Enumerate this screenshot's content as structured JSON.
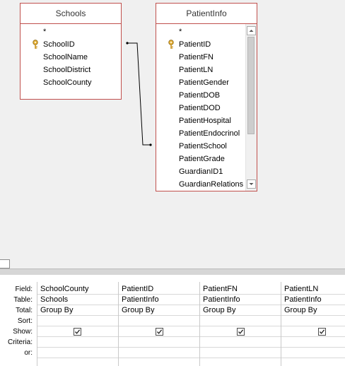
{
  "diagram": {
    "tables": [
      {
        "title": "Schools",
        "fields": [
          "*",
          "SchoolID",
          "SchoolName",
          "SchoolDistrict",
          "SchoolCounty"
        ],
        "key_field": "SchoolID"
      },
      {
        "title": "PatientInfo",
        "fields": [
          "*",
          "PatientID",
          "PatientFN",
          "PatientLN",
          "PatientGender",
          "PatientDOB",
          "PatientDOD",
          "PatientHospital",
          "PatientEndocrinol",
          "PatientSchool",
          "PatientGrade",
          "GuardianID1",
          "GuardianRelations"
        ],
        "key_field": "PatientID"
      }
    ],
    "relationship": {
      "from": "Schools.SchoolID",
      "to": "PatientInfo.PatientSchool"
    }
  },
  "grid": {
    "row_labels": {
      "field": "Field:",
      "table": "Table:",
      "total": "Total:",
      "sort": "Sort:",
      "show": "Show:",
      "criteria": "Criteria:",
      "or": "or:"
    },
    "columns": [
      {
        "field": "SchoolCounty",
        "table": "Schools",
        "total": "Group By",
        "sort": "",
        "show": true,
        "criteria": "",
        "or": ""
      },
      {
        "field": "PatientID",
        "table": "PatientInfo",
        "total": "Group By",
        "sort": "",
        "show": true,
        "criteria": "",
        "or": ""
      },
      {
        "field": "PatientFN",
        "table": "PatientInfo",
        "total": "Group By",
        "sort": "",
        "show": true,
        "criteria": "",
        "or": ""
      },
      {
        "field": "PatientLN",
        "table": "PatientInfo",
        "total": "Group By",
        "sort": "",
        "show": true,
        "criteria": "",
        "or": ""
      }
    ]
  },
  "colors": {
    "table_border": "#c0504d",
    "diagram_bg": "#f0f0f0",
    "relationship_line": "#000000"
  },
  "icons": {
    "key": "primary-key-icon",
    "checkbox_checked": "checkmark-icon",
    "scroll_up": "scroll-up-arrow-icon",
    "scroll_down": "scroll-down-arrow-icon"
  }
}
